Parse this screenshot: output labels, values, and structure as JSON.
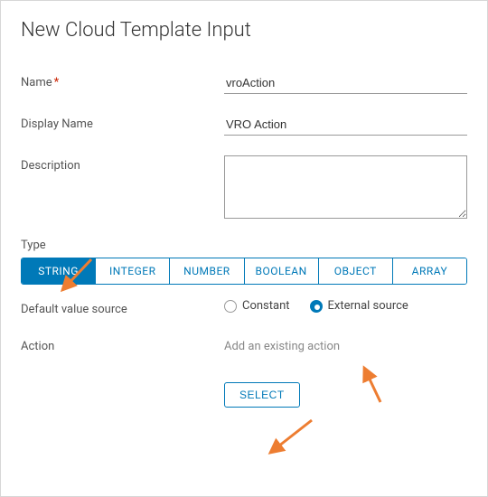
{
  "title": "New Cloud Template Input",
  "fields": {
    "name": {
      "label": "Name",
      "value": "vroAction",
      "required": true
    },
    "display": {
      "label": "Display Name",
      "value": "VRO Action"
    },
    "description": {
      "label": "Description",
      "value": ""
    }
  },
  "type": {
    "label": "Type",
    "tabs": [
      "STRING",
      "INTEGER",
      "NUMBER",
      "BOOLEAN",
      "OBJECT",
      "ARRAY"
    ],
    "active": "STRING"
  },
  "defaultSource": {
    "label": "Default value source",
    "options": {
      "constant": "Constant",
      "external": "External source"
    },
    "selected": "external"
  },
  "action": {
    "label": "Action",
    "placeholder": "Add an existing action",
    "button": "SELECT"
  }
}
